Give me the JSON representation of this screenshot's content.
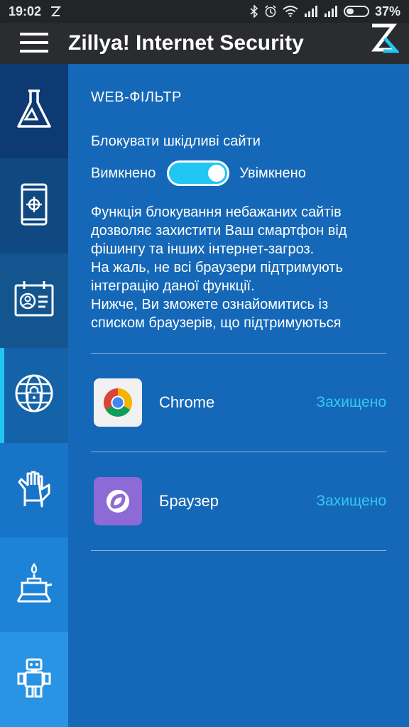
{
  "status_bar": {
    "time": "19:02",
    "notification_icon": "zillya-notification-icon",
    "icons": [
      "bluetooth-icon",
      "alarm-icon",
      "wifi-icon",
      "signal-icon",
      "signal-icon",
      "battery-icon"
    ],
    "battery_percent": "37%",
    "battery_level": 0.37
  },
  "app_bar": {
    "title": "Zillya! Internet Security",
    "menu_icon": "hamburger-menu-icon",
    "logo_icon": "zillya-logo-icon"
  },
  "sidebar": {
    "items": [
      {
        "name": "flask-icon",
        "color": "#0d3a72"
      },
      {
        "name": "phone-target-icon",
        "color": "#104881"
      },
      {
        "name": "id-card-icon",
        "color": "#13558f"
      },
      {
        "name": "globe-lock-icon",
        "color": "#1462a8",
        "active": true
      },
      {
        "name": "glove-icon",
        "color": "#1874c7"
      },
      {
        "name": "burner-icon",
        "color": "#1d83d6"
      },
      {
        "name": "robot-icon",
        "color": "#2993e4"
      }
    ],
    "active_indicator_color": "#21c6f3"
  },
  "web_filter": {
    "section_title": "WEB-ФІЛЬТР",
    "block_label": "Блокувати шкідливі сайти",
    "toggle_off_label": "Вимкнено",
    "toggle_on_label": "Увімкнено",
    "toggle_state": "on",
    "description_lines": [
      "Функція блокування небажаних сайтів",
      "дозволяє захистити Ваш смартфон від",
      "фішингу та інших інтернет-загроз.",
      "На жаль, не всі браузери підтримують",
      "інтеграцію даної функції.",
      "Нижче, Ви зможете ознайомитись із",
      "списком браузерів, що підтримуються"
    ]
  },
  "browsers": [
    {
      "name": "Chrome",
      "status": "Захищено",
      "icon": "chrome-icon"
    },
    {
      "name": "Браузер",
      "status": "Захищено",
      "icon": "browser-icon"
    }
  ],
  "colors": {
    "background": "#1568b8",
    "accent": "#21c6f3",
    "status_text": "#34c8f4",
    "appbar": "#2a2c2f"
  }
}
